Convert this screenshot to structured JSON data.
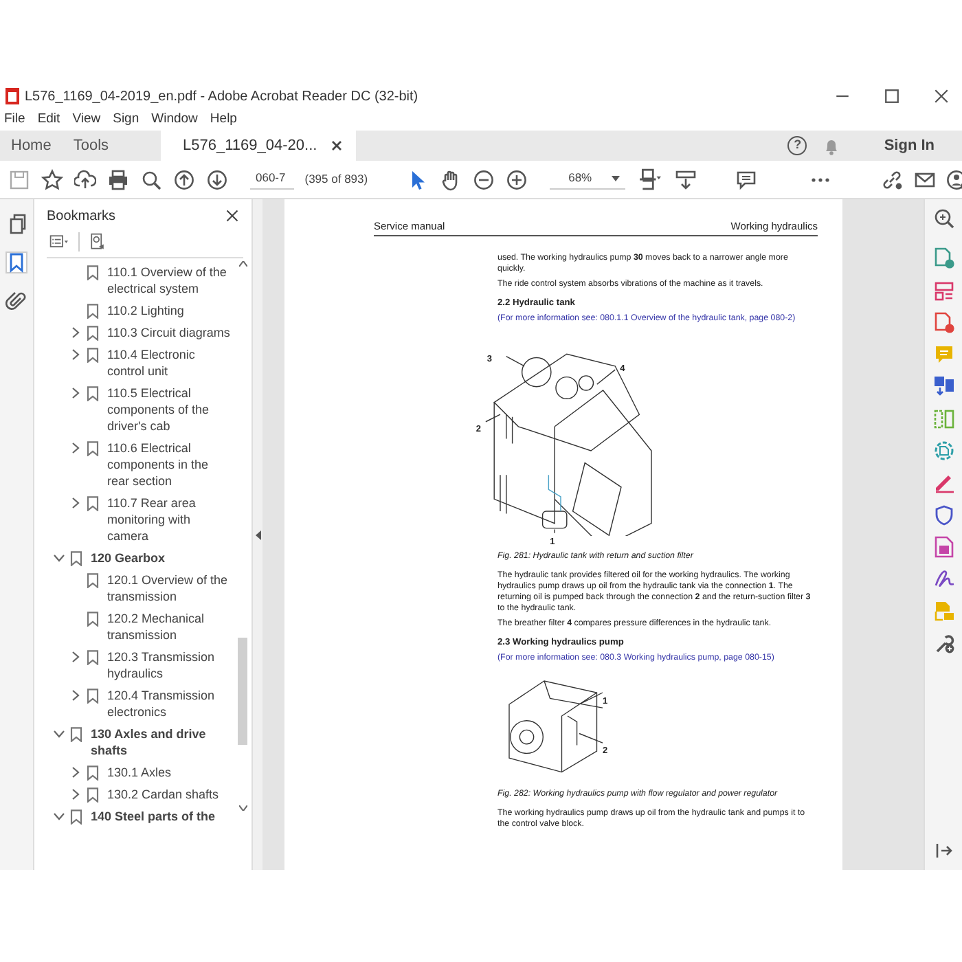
{
  "window": {
    "title": "L576_1169_04-2019_en.pdf - Adobe Acrobat Reader DC (32-bit)"
  },
  "menu": [
    "File",
    "Edit",
    "View",
    "Sign",
    "Window",
    "Help"
  ],
  "tabs": [
    {
      "label": "Home",
      "kind": "nav",
      "selected": false
    },
    {
      "label": "Tools",
      "kind": "nav",
      "selected": false
    },
    {
      "label": "L576_1169_04-20...",
      "kind": "document",
      "selected": true
    }
  ],
  "help_glyph": "?",
  "sign_in": "Sign In",
  "toolbar": {
    "page": "060-7",
    "page_count": "(395 of 893)",
    "zoom": "68%"
  },
  "left_rail": [
    {
      "kind": "pages",
      "selected": false
    },
    {
      "kind": "bookmarks",
      "selected": true
    },
    {
      "kind": "attachments",
      "selected": false
    }
  ],
  "bookmarks": {
    "title": "Bookmarks",
    "continued_children": [
      {
        "label": "110.1 Overview of the electrical system",
        "kind": "leaf"
      },
      {
        "label": "110.2 Lighting",
        "kind": "leaf"
      },
      {
        "label": "110.3 Circuit diagrams",
        "kind": "branch",
        "expanded": false
      },
      {
        "label": "110.4 Electronic control unit",
        "kind": "branch",
        "expanded": false
      },
      {
        "label": "110.5 Electrical components of the driver's cab",
        "kind": "branch",
        "expanded": false
      },
      {
        "label": "110.6 Electrical components in the rear section",
        "kind": "branch",
        "expanded": false
      },
      {
        "label": "110.7 Rear area monitoring with camera",
        "kind": "branch",
        "expanded": false
      }
    ],
    "items": [
      {
        "label": "120 Gearbox",
        "kind": "branch",
        "expanded": true,
        "children": [
          {
            "label": "120.1 Overview of the transmission",
            "kind": "leaf"
          },
          {
            "label": "120.2 Mechanical transmission",
            "kind": "leaf"
          },
          {
            "label": "120.3 Transmission hydraulics",
            "kind": "branch",
            "expanded": false
          },
          {
            "label": "120.4 Transmission electronics",
            "kind": "branch",
            "expanded": false
          }
        ]
      },
      {
        "label": "130 Axles and drive shafts",
        "kind": "branch",
        "expanded": true,
        "children": [
          {
            "label": "130.1 Axles",
            "kind": "branch",
            "expanded": false
          },
          {
            "label": "130.2 Cardan shafts",
            "kind": "branch",
            "expanded": false
          }
        ]
      },
      {
        "label": "140 Steel parts of the",
        "kind": "branch",
        "expanded": true
      }
    ]
  },
  "page": {
    "header_left": "Service manual",
    "header_right": "Working hydraulics",
    "blocks": [
      {
        "kind": "paragraph",
        "text": "used. The working hydraulics pump **30** moves back to a narrower angle more quickly."
      },
      {
        "kind": "paragraph",
        "text": "The ride control system absorbs vibrations of the machine as it travels."
      },
      {
        "kind": "heading",
        "text": "2.2 Hydraulic tank"
      },
      {
        "kind": "link",
        "text": "(For more information see: 080.1.1 Overview of the hydraulic tank, page 080-2)"
      },
      {
        "kind": "tank_figure",
        "callouts": [
          "3",
          "4",
          "2",
          "1"
        ]
      },
      {
        "kind": "caption",
        "text": "Fig. 281: Hydraulic tank with return and suction filter"
      },
      {
        "kind": "paragraph",
        "text": "The hydraulic tank provides filtered oil for the working hydraulics. The working hydraulics pump draws up oil from the hydraulic tank via the connection **1**. The returning oil is pumped back through the connection **2** and the return-suction filter **3** to the hydraulic tank."
      },
      {
        "kind": "paragraph",
        "text": "The breather filter **4** compares pressure differences in the hydraulic tank."
      },
      {
        "kind": "heading",
        "text": "2.3 Working hydraulics pump"
      },
      {
        "kind": "link",
        "text": "(For more information see: 080.3 Working hydraulics pump, page 080-15)"
      },
      {
        "kind": "pump_figure",
        "callouts": [
          "1",
          "2"
        ]
      },
      {
        "kind": "caption",
        "text": "Fig. 282: Working hydraulics pump with flow regulator and power regulator"
      },
      {
        "kind": "paragraph",
        "text": "The working hydraulics pump draws up oil from the hydraulic tank and pumps it to the control valve block."
      }
    ]
  },
  "right_tools": [
    {
      "kind": "zoom",
      "color": "#555555"
    },
    {
      "kind": "doc-badge",
      "color": "#3a9a8a"
    },
    {
      "kind": "layout",
      "color": "#d9386a"
    },
    {
      "kind": "doc-badge",
      "color": "#e0443e"
    },
    {
      "kind": "comment",
      "color": "#e8b400"
    },
    {
      "kind": "doc-arrow",
      "color": "#3a5fcd"
    },
    {
      "kind": "columns",
      "color": "#6bb33c"
    },
    {
      "kind": "doc-gear",
      "color": "#2d9fa8"
    },
    {
      "kind": "pen",
      "color": "#d9386a"
    },
    {
      "kind": "shield",
      "color": "#4a55c8"
    },
    {
      "kind": "form",
      "color": "#c545a8"
    },
    {
      "kind": "signature",
      "color": "#7b4bc4"
    },
    {
      "kind": "doc-comment",
      "color": "#e8b400"
    },
    {
      "kind": "wrench",
      "color": "#555555"
    }
  ]
}
